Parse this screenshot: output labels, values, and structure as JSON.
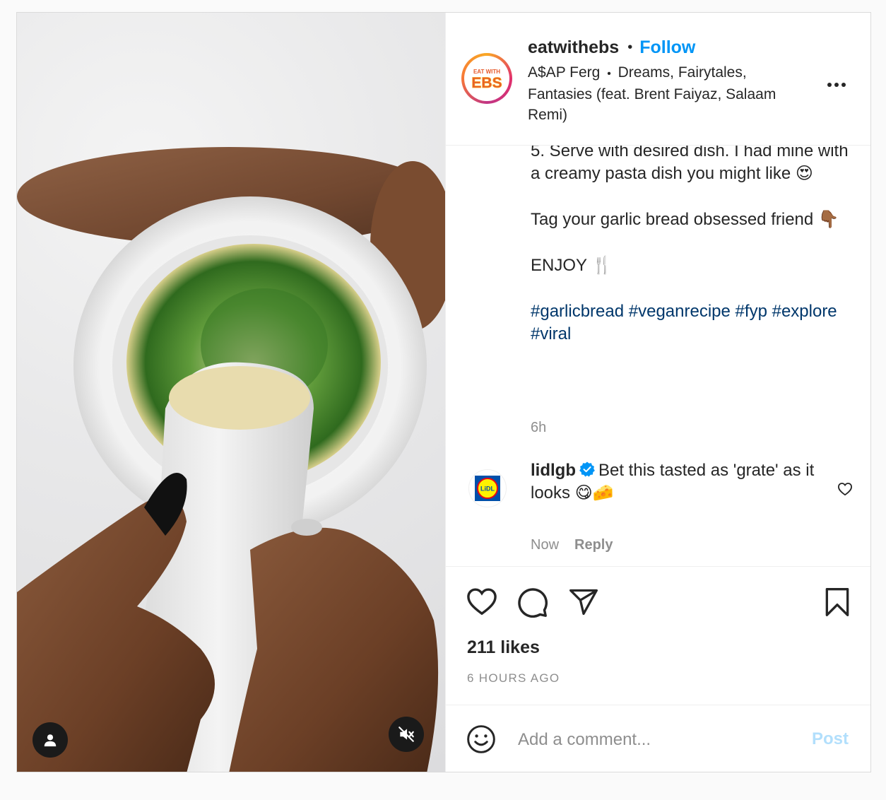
{
  "post": {
    "username": "eatwithebs",
    "follow_label": "Follow",
    "separator": "•",
    "avatar_text_top": "EAT WITH",
    "avatar_text_main": "EBS",
    "audio_artist": "A$AP Ferg",
    "audio_track": "Dreams, Fairytales, Fantasies (feat. Brent Faiyaz, Salaam Remi)",
    "more_icon": "more-horizontal-icon"
  },
  "caption": {
    "line_step": "5. Serve with desired dish. I had mine with a creamy pasta dish you might like 😍",
    "line_tag": "Tag your garlic bread obsessed friend 👇🏾",
    "line_enjoy": "ENJOY 🍴",
    "hashtags": [
      "#garlicbread",
      "#veganrecipe",
      "#fyp",
      "#explore",
      "#viral"
    ],
    "time": "6h"
  },
  "comment": {
    "username": "lidlgb",
    "avatar_text": "LiDL",
    "text": "Bet this tasted as 'grate' as it looks 😋🧀",
    "time": "Now",
    "reply_label": "Reply"
  },
  "actions": {
    "icons": [
      "heart-icon",
      "comment-icon",
      "share-icon",
      "bookmark-icon"
    ],
    "likes": "211 likes",
    "posted": "6 HOURS AGO"
  },
  "add_comment": {
    "placeholder": "Add a comment...",
    "post_label": "Post"
  },
  "colors": {
    "accent": "#0095f6",
    "hashtag": "#00376b",
    "muted": "#8e8e8e",
    "post_disabled": "#b2dffc"
  }
}
